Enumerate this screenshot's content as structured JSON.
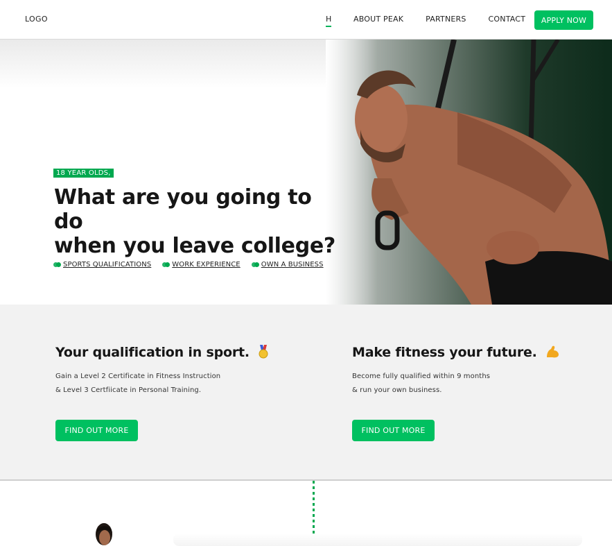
{
  "nav": {
    "logo": "LOGO",
    "links": [
      "H",
      "ABOUT PEAK",
      "PARTNERS",
      "CONTACT"
    ],
    "apply": "APPLY NOW"
  },
  "hero": {
    "tag": "18 YEAR OLDS,",
    "headline_line1": "What are you going to do",
    "headline_line2": "when you leave college?",
    "chips": [
      "SPORTS QUALIFICATIONS",
      "WORK EXPERIENCE",
      "OWN A BUSINESS"
    ],
    "scroll_icon": "chevron-down-icon",
    "image": "athlete-photo"
  },
  "cards": [
    {
      "title": "Your qualification in sport.",
      "emoji": "medal-icon",
      "line1": "Gain a Level 2 Certificate in Fitness Instruction",
      "line2": "& Level 3 Certfiicate in Personal Training.",
      "button": "FIND OUT MORE"
    },
    {
      "title": "Make fitness your future.",
      "emoji": "flexed-bicep-icon",
      "line1": "Become fully qualified within 9 months",
      "line2": "& run your own business.",
      "button": "FIND OUT MORE"
    }
  ],
  "colors": {
    "accent": "#00c060",
    "accent_dark": "#00a84f",
    "section_bg": "#f2f2f2"
  }
}
